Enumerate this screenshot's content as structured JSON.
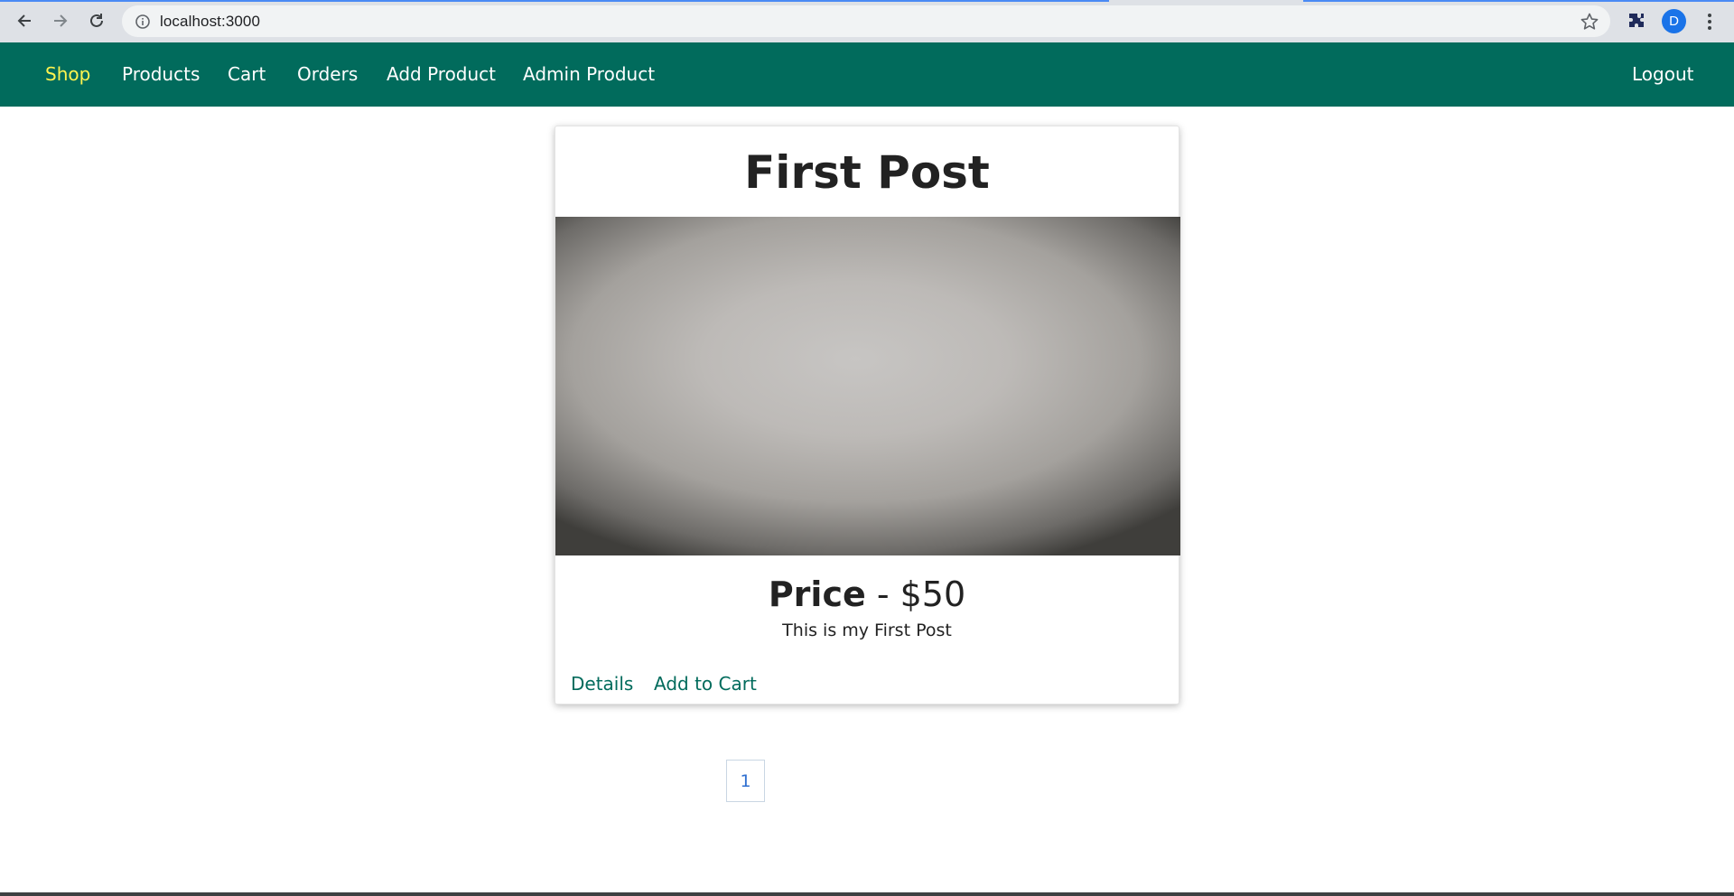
{
  "browser": {
    "url": "localhost:3000",
    "profile_initial": "D",
    "icons": {
      "back": "back-arrow-icon",
      "forward": "forward-arrow-icon",
      "reload": "reload-icon",
      "info": "info-icon",
      "star": "star-icon",
      "extensions": "puzzle-icon",
      "menu": "menu-dots-icon"
    }
  },
  "nav": {
    "items": [
      {
        "label": "Shop",
        "active": true
      },
      {
        "label": "Products",
        "active": false
      },
      {
        "label": "Cart",
        "active": false
      },
      {
        "label": "Orders",
        "active": false
      },
      {
        "label": "Add Product",
        "active": false
      },
      {
        "label": "Admin Product",
        "active": false
      }
    ],
    "logout": "Logout"
  },
  "product": {
    "title": "First Post",
    "price_label": "Price",
    "price_separator": " - ",
    "price_value": "$50",
    "description": "This is my First Post",
    "actions": {
      "details": "Details",
      "add_to_cart": "Add to Cart"
    }
  },
  "pagination": {
    "pages": [
      "1"
    ]
  },
  "colors": {
    "header_bg": "#016b5c",
    "active_nav": "#fff44f",
    "link": "#016b5c",
    "page_link": "#2f6fd0"
  }
}
